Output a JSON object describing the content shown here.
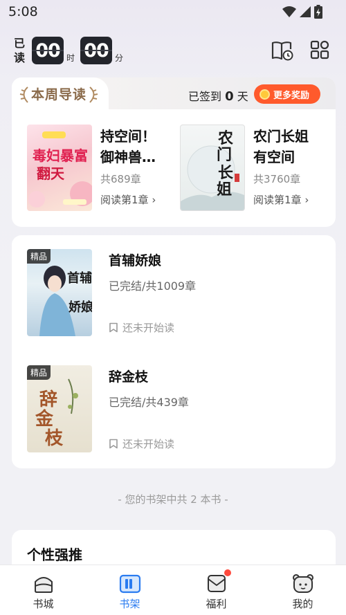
{
  "status_bar": {
    "time": "5:08"
  },
  "reading_timer": {
    "label_line1": "已",
    "label_line2": "读",
    "hours": "00",
    "hours_unit": "时",
    "minutes": "00",
    "minutes_unit": "分"
  },
  "header_icons": [
    "reading-history-icon",
    "grid-apps-icon"
  ],
  "weekly": {
    "title": "本周导读",
    "checkin_prefix": "已签到",
    "checkin_days": "0",
    "checkin_suffix": "天",
    "reward_label": "更多奖励",
    "books": [
      {
        "title_line1": "持空间！",
        "title_line2": "御神兽…",
        "chapters": "共689章",
        "read_link": "阅读第1章",
        "cover_text": "毒妇暴富"
      },
      {
        "title_line1": "农门长姐",
        "title_line2": "有空间",
        "chapters": "共3760章",
        "read_link": "阅读第1章",
        "cover_text": "农门长姐"
      }
    ]
  },
  "shelf": {
    "books": [
      {
        "badge": "精品",
        "title": "首辅娇娘",
        "status": "已完结/共1009章",
        "progress": "还未开始读",
        "cover_text": "首辅娇娘"
      },
      {
        "badge": "精品",
        "title": "辞金枝",
        "status": "已完结/共439章",
        "progress": "还未开始读",
        "cover_text": "辞金枝"
      }
    ],
    "count_text": "- 您的书架中共 2 本书 -"
  },
  "recommend": {
    "title": "个性强推"
  },
  "nav": {
    "items": [
      {
        "label": "书城",
        "icon": "bookstore-icon"
      },
      {
        "label": "书架",
        "icon": "bookshelf-icon"
      },
      {
        "label": "福利",
        "icon": "welfare-icon"
      },
      {
        "label": "我的",
        "icon": "profile-icon"
      }
    ],
    "active_index": 1,
    "colors": {
      "active": "#2a7bf0",
      "badge": "#ff4a3d",
      "reward": "#ff5a2c"
    }
  }
}
